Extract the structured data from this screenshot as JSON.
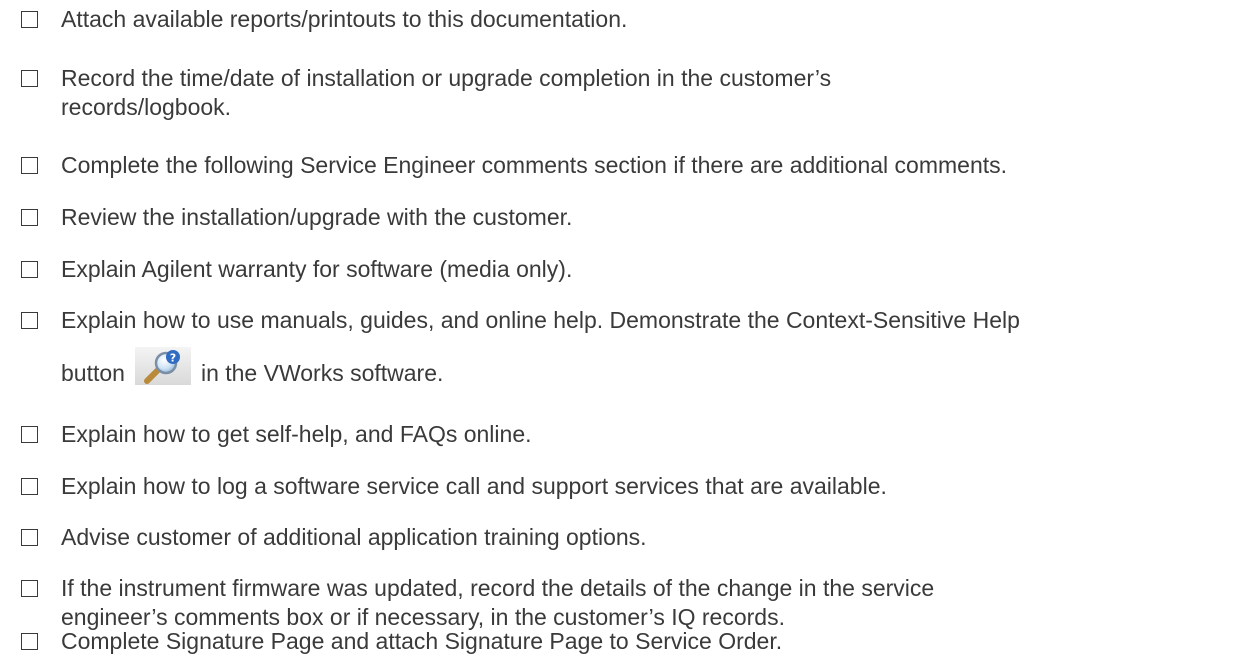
{
  "checklist": {
    "items": [
      {
        "lines": [
          "Attach available reports/printouts to this documentation."
        ]
      },
      {
        "lines": [
          "Record the time/date of installation or upgrade completion in the customer’s",
          "records/logbook."
        ]
      },
      {
        "lines": [
          "Complete the following Service Engineer comments section if there are additional comments."
        ]
      },
      {
        "lines": [
          "Review the installation/upgrade with the customer."
        ]
      },
      {
        "lines": [
          "Explain Agilent warranty for software (media only)."
        ]
      },
      {
        "lines": [
          "Explain how to use manuals, guides, and online help. Demonstrate the Context-Sensitive Help"
        ],
        "line2_before": "button",
        "line2_after": "in the VWorks software.",
        "icon": "context-sensitive-help-icon"
      },
      {
        "lines": [
          "Explain how to get self-help, and FAQs online."
        ]
      },
      {
        "lines": [
          "Explain how to log a software service call and support services that are available."
        ]
      },
      {
        "lines": [
          "Advise customer of additional application training options."
        ]
      },
      {
        "lines": [
          "If the instrument firmware was updated, record the details of the change in the service",
          "engineer’s comments box or if necessary, in the customer’s IQ records."
        ]
      },
      {
        "lines": [
          "Complete Signature Page and attach Signature Page to Service Order."
        ]
      }
    ]
  }
}
